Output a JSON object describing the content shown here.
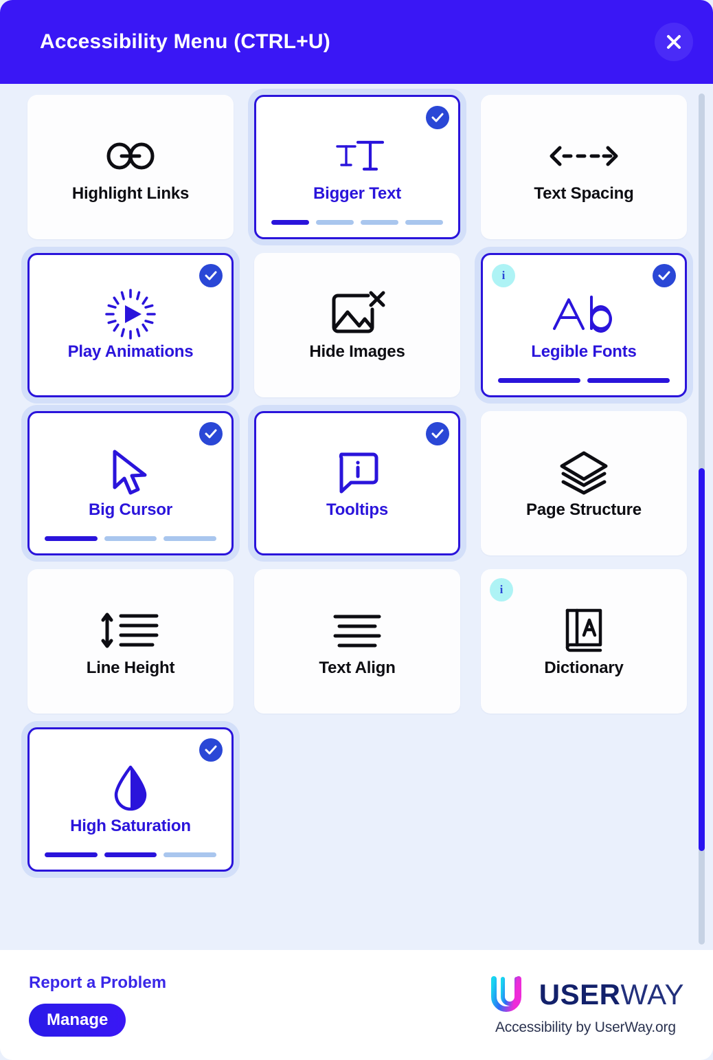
{
  "header": {
    "title": "Accessibility Menu (CTRL+U)",
    "close_icon": "close-icon",
    "bg_color": "#3A17F5"
  },
  "colors": {
    "accent": "#2A14DB",
    "header": "#3A17F5",
    "body_bg": "#EAF0FC",
    "check_badge": "#2A47D6",
    "info_badge": "#AEF3F5",
    "progress_off": "#A9C6EE",
    "scrollbar_thumb": "#2A14F0"
  },
  "cards": [
    {
      "id": "highlight-links",
      "label": "Highlight Links",
      "icon": "link-icon",
      "active": false,
      "info": false,
      "segments": 0,
      "filled": 0
    },
    {
      "id": "bigger-text",
      "label": "Bigger Text",
      "icon": "bigger-text-icon",
      "active": true,
      "info": false,
      "segments": 4,
      "filled": 1
    },
    {
      "id": "text-spacing",
      "label": "Text Spacing",
      "icon": "text-spacing-icon",
      "active": false,
      "info": false,
      "segments": 0,
      "filled": 0
    },
    {
      "id": "play-animations",
      "label": "Play Animations",
      "icon": "play-animations-icon",
      "active": true,
      "info": false,
      "segments": 0,
      "filled": 0
    },
    {
      "id": "hide-images",
      "label": "Hide Images",
      "icon": "hide-images-icon",
      "active": false,
      "info": false,
      "segments": 0,
      "filled": 0
    },
    {
      "id": "legible-fonts",
      "label": "Legible Fonts",
      "icon": "legible-fonts-icon",
      "active": true,
      "info": true,
      "segments": 2,
      "filled": 2
    },
    {
      "id": "big-cursor",
      "label": "Big Cursor",
      "icon": "cursor-icon",
      "active": true,
      "info": false,
      "segments": 3,
      "filled": 1
    },
    {
      "id": "tooltips",
      "label": "Tooltips",
      "icon": "tooltip-icon",
      "active": true,
      "info": false,
      "segments": 0,
      "filled": 0
    },
    {
      "id": "page-structure",
      "label": "Page Structure",
      "icon": "layers-icon",
      "active": false,
      "info": false,
      "segments": 0,
      "filled": 0
    },
    {
      "id": "line-height",
      "label": "Line Height",
      "icon": "line-height-icon",
      "active": false,
      "info": false,
      "segments": 0,
      "filled": 0
    },
    {
      "id": "text-align",
      "label": "Text Align",
      "icon": "text-align-icon",
      "active": false,
      "info": false,
      "segments": 0,
      "filled": 0
    },
    {
      "id": "dictionary",
      "label": "Dictionary",
      "icon": "dictionary-icon",
      "active": false,
      "info": true,
      "segments": 0,
      "filled": 0
    },
    {
      "id": "high-saturation",
      "label": "High Saturation",
      "icon": "droplet-icon",
      "active": true,
      "info": false,
      "segments": 3,
      "filled": 2
    }
  ],
  "info_badge_label": "i",
  "footer": {
    "report_label": "Report a Problem",
    "manage_label": "Manage",
    "brand_first": "USER",
    "brand_second": "WAY",
    "tagline": "Accessibility by UserWay.org",
    "logo_icon": "userway-logo-icon"
  }
}
